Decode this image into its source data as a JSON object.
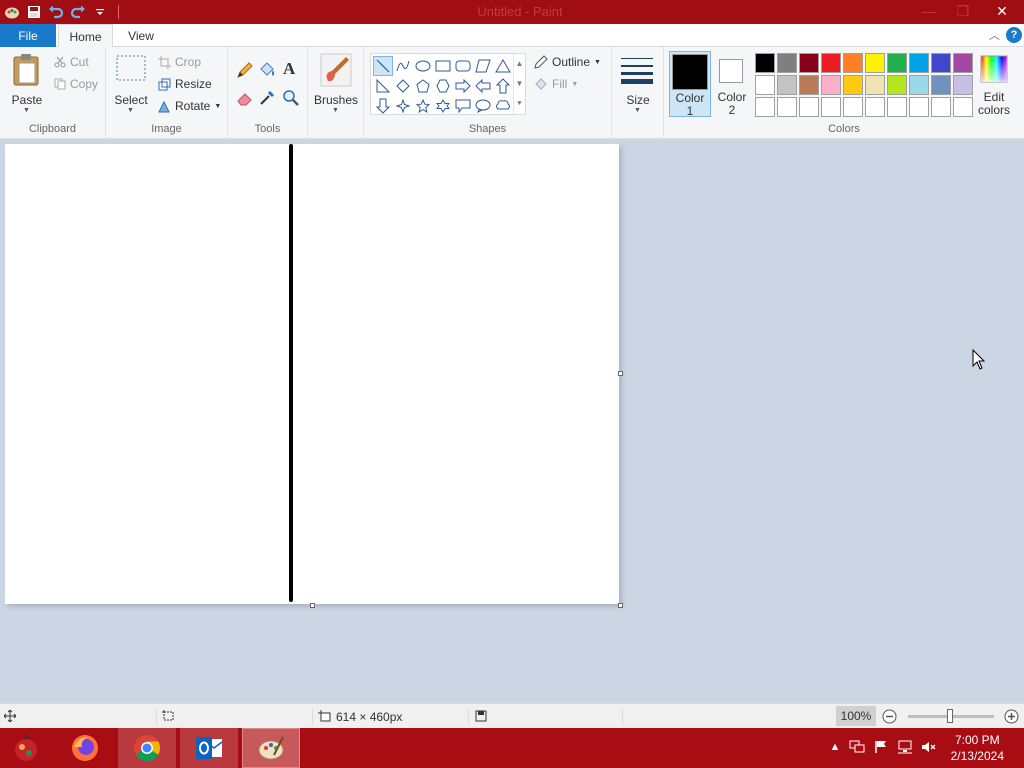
{
  "window": {
    "title": "Untitled - Paint",
    "minimize": "—",
    "maximize": "❐",
    "close": "✕"
  },
  "tabs": {
    "file": "File",
    "home": "Home",
    "view": "View"
  },
  "ribbon": {
    "clipboard": {
      "paste": "Paste",
      "cut": "Cut",
      "copy": "Copy",
      "label": "Clipboard"
    },
    "image": {
      "select": "Select",
      "crop": "Crop",
      "resize": "Resize",
      "rotate": "Rotate",
      "label": "Image"
    },
    "tools": {
      "label": "Tools"
    },
    "brushes": {
      "label": "Brushes"
    },
    "shapes": {
      "outline": "Outline",
      "fill": "Fill",
      "label": "Shapes"
    },
    "size": {
      "label": "Size"
    },
    "colors": {
      "color1_line1": "Color",
      "color1_line2": "1",
      "color2_line1": "Color",
      "color2_line2": "2",
      "edit_line1": "Edit",
      "edit_line2": "colors",
      "label": "Colors",
      "color1_value": "#000000",
      "color2_value": "#ffffff",
      "palette": [
        "#000000",
        "#7f7f7f",
        "#880015",
        "#ed1c24",
        "#ff7f27",
        "#fff200",
        "#22b14c",
        "#00a2e8",
        "#3f48cc",
        "#a349a4",
        "#ffffff",
        "#c3c3c3",
        "#b97a57",
        "#ffaec9",
        "#ffc90e",
        "#efe4b0",
        "#b5e61d",
        "#99d9ea",
        "#7092be",
        "#c8bfe7",
        "#ffffff",
        "#ffffff",
        "#ffffff",
        "#ffffff",
        "#ffffff",
        "#ffffff",
        "#ffffff",
        "#ffffff",
        "#ffffff",
        "#ffffff"
      ]
    }
  },
  "status": {
    "canvas_size": "614 × 460px",
    "zoom": "100%"
  },
  "taskbar": {
    "time": "7:00 PM",
    "date": "2/13/2024"
  }
}
